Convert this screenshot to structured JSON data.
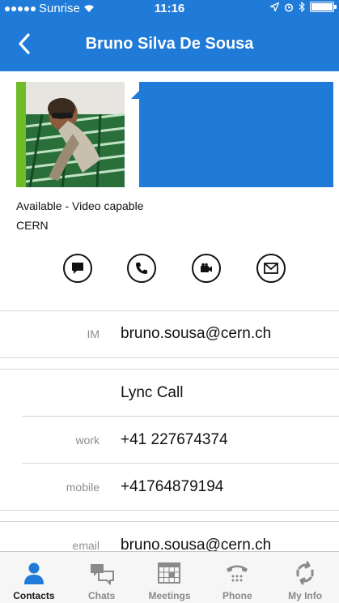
{
  "status_bar": {
    "carrier": "Sunrise",
    "time": "11:16"
  },
  "nav": {
    "title": "Bruno Silva De Sousa",
    "back_icon": "chevron-left-icon"
  },
  "profile": {
    "presence_color": "#6fbb28",
    "accent_color": "#1f7ad8",
    "availability": "Available - Video capable",
    "organization": "CERN"
  },
  "actions": [
    {
      "icon": "chat-bubble-icon"
    },
    {
      "icon": "phone-icon"
    },
    {
      "icon": "video-camera-icon"
    },
    {
      "icon": "mail-icon"
    }
  ],
  "details": [
    {
      "label": "IM",
      "value": "bruno.sousa@cern.ch"
    },
    {
      "label": "",
      "value": "Lync Call"
    },
    {
      "label": "work",
      "value": "+41 227674374"
    },
    {
      "label": "mobile",
      "value": "+41764879194"
    },
    {
      "label": "email",
      "value": "bruno.sousa@cern.ch"
    }
  ],
  "tabs": [
    {
      "label": "Contacts",
      "icon": "person-icon",
      "active": true
    },
    {
      "label": "Chats",
      "icon": "chats-icon",
      "active": false
    },
    {
      "label": "Meetings",
      "icon": "calendar-icon",
      "active": false
    },
    {
      "label": "Phone",
      "icon": "phone-handset-icon",
      "active": false
    },
    {
      "label": "My Info",
      "icon": "refresh-icon",
      "active": false
    }
  ]
}
